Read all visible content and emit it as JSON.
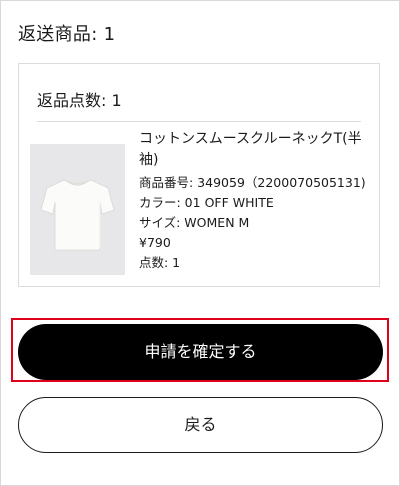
{
  "return_items": {
    "title": "返送商品: 1",
    "card": {
      "count_label": "返品点数: 1",
      "product": {
        "image_icon": "white-tshirt-image",
        "name": "コットンスムースクルーネックT(半袖)",
        "number": "商品番号: 349059（2200070505131)",
        "color": "カラー: 01 OFF WHITE",
        "size": "サイズ: WOMEN M",
        "price": "¥790",
        "quantity": "点数: 1"
      }
    }
  },
  "actions": {
    "confirm_label": "申請を確定する",
    "back_label": "戻る"
  },
  "colors": {
    "primary_button_bg": "#000000",
    "focus_outline": "#e0001a",
    "border": "#dcdcdc"
  }
}
